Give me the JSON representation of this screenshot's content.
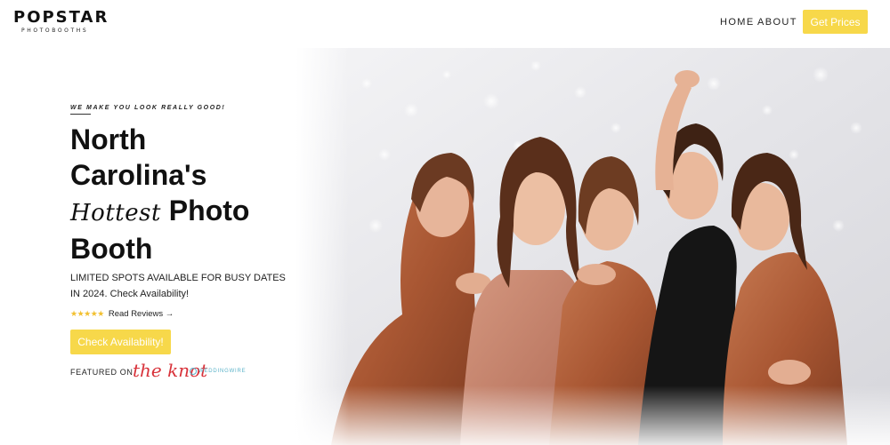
{
  "header": {
    "logo_main": "POPSTAR",
    "logo_sub": "PHOTOBOOTHS",
    "nav": {
      "home": "HOME",
      "about": "ABOUT"
    },
    "cta": "Get Prices"
  },
  "hero": {
    "tagline": "WE MAKE YOU LOOK REALLY GOOD!",
    "headline_line1": "North",
    "headline_line2": "Carolina's",
    "headline_script": "Hottest",
    "headline_line3_rest": "Photo",
    "headline_line4": "Booth",
    "subtext": "LIMITED SPOTS AVAILABLE FOR BUSY DATES IN 2024. Check Availability!",
    "stars": "★★★★★",
    "reviews_link": "Read Reviews →",
    "cta": "Check Availability!",
    "featured_label": "FEATURED ON",
    "featured_logo_1": "the knot",
    "featured_logo_2": "WEDDINGWIRE"
  },
  "colors": {
    "accent_yellow": "#f7d84a",
    "star_gold": "#f2c030",
    "knot_red": "#d8323a",
    "weddingwire_teal": "#5bb3c9",
    "dress_copper": "#b5653f",
    "dress_black": "#151515"
  },
  "icons": {
    "arrow": "arrow-right-icon",
    "stars": "star-icon",
    "weddingwire": "weddingwire-ring-icon"
  }
}
